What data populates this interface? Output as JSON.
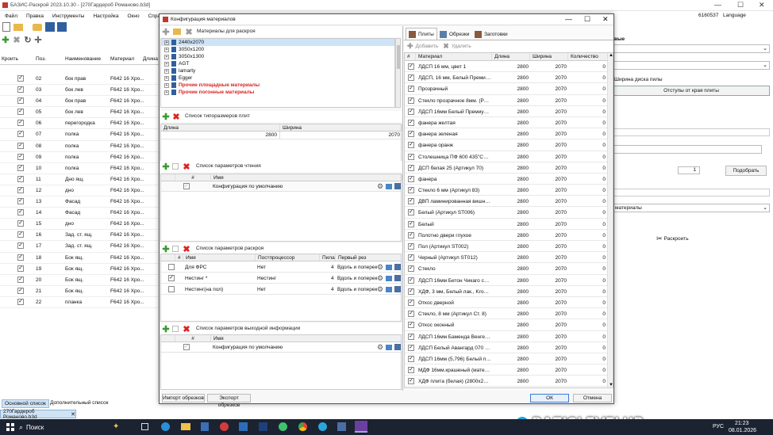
{
  "app": {
    "title": "БАЗИС-Раскрой 2023.10.30 - [270Гардероб Романово.b3d]",
    "menu": [
      "Файл",
      "Правка",
      "Инструменты",
      "Настройка",
      "Окно",
      "Справка"
    ],
    "status_num": "6160537",
    "language": "Language"
  },
  "left_table": {
    "columns": [
      "Кроить",
      "Поз.",
      "Наименование",
      "Материал",
      "Длина"
    ],
    "rows": [
      {
        "pos": "02",
        "name": "бок прав",
        "mat": "F642 16 Хро..."
      },
      {
        "pos": "03",
        "name": "бок лев",
        "mat": "F642 16 Хро..."
      },
      {
        "pos": "04",
        "name": "бок прав",
        "mat": "F642 16 Хро..."
      },
      {
        "pos": "05",
        "name": "бок лев",
        "mat": "F642 16 Хро..."
      },
      {
        "pos": "06",
        "name": "перегородка",
        "mat": "F642 16 Хро..."
      },
      {
        "pos": "07",
        "name": "полка",
        "mat": "F642 16 Хро..."
      },
      {
        "pos": "08",
        "name": "полка",
        "mat": "F642 16 Хро..."
      },
      {
        "pos": "09",
        "name": "полка",
        "mat": "F642 16 Хро..."
      },
      {
        "pos": "10",
        "name": "полка",
        "mat": "F642 16 Хро..."
      },
      {
        "pos": "11",
        "name": "Дно ящ.",
        "mat": "F642 16 Хро..."
      },
      {
        "pos": "12",
        "name": "дно",
        "mat": "F642 16 Хро..."
      },
      {
        "pos": "13",
        "name": "Фасад",
        "mat": "F642 16 Хро..."
      },
      {
        "pos": "14",
        "name": "Фасад",
        "mat": "F642 16 Хро..."
      },
      {
        "pos": "15",
        "name": "дно",
        "mat": "F642 16 Хро..."
      },
      {
        "pos": "16",
        "name": "Зад. ст. ящ.",
        "mat": "F642 16 Хро..."
      },
      {
        "pos": "17",
        "name": "Зад. ст. ящ.",
        "mat": "F642 16 Хро..."
      },
      {
        "pos": "18",
        "name": "Бок ящ.",
        "mat": "F642 16 Хро..."
      },
      {
        "pos": "19",
        "name": "Бок ящ.",
        "mat": "F642 16 Хро..."
      },
      {
        "pos": "20",
        "name": "Бок ящ.",
        "mat": "F642 16 Хро..."
      },
      {
        "pos": "21",
        "name": "Бок ящ.",
        "mat": "F642 16 Хро..."
      },
      {
        "pos": "22",
        "name": "планка",
        "mat": "F642 16 Хро..."
      }
    ],
    "tabs": [
      "Основной список",
      "Дополнительный список"
    ],
    "doc_tab": "270Гардероб Романово.b3d"
  },
  "right_panel": {
    "header": "вые",
    "label_disk": "Ширина диска пилы",
    "btn_offsets": "Отступы от края плиты",
    "stepper_value": "1",
    "btn_select": "Подобрать",
    "dropdown_mat": "материалы",
    "btn_cut": "Раскроить"
  },
  "dialog": {
    "title": "Конфигурация материалов",
    "materials": {
      "title": "Материалы для раскроя",
      "items": [
        "2440x2070",
        "3050x1200",
        "3050x1300",
        "AGT",
        "lamarty",
        "Egger"
      ],
      "special": [
        "Прочие площадные материалы",
        "Прочие погонные материалы"
      ]
    },
    "sizes": {
      "title": "Список типоразмеров плит",
      "col_len": "Длина",
      "col_wid": "Ширина",
      "len": "2800",
      "wid": "2070"
    },
    "read": {
      "title": "Список параметров чтения",
      "col_num": "#",
      "col_name": "Имя",
      "row_name": "Конфигурация по умолчанию"
    },
    "cut": {
      "title": "Список параметров раскроя",
      "cols": [
        "#",
        "Имя",
        "Постпроцессор",
        "Пила",
        "Первый рез"
      ],
      "rows": [
        {
          "checked": false,
          "name": "Для ФРС",
          "post": "Нет",
          "saw": "4",
          "first": "Вдоль и поперек"
        },
        {
          "checked": true,
          "name": "Нестинг *",
          "post": "Нестинг",
          "saw": "4",
          "first": "Вдоль и поперек"
        },
        {
          "checked": false,
          "name": "Нестинг(на пол)",
          "post": "Нет",
          "saw": "4",
          "first": "Вдоль и поперек"
        }
      ]
    },
    "out": {
      "title": "Список параметров выходной информации",
      "col_num": "#",
      "col_name": "Имя",
      "row_name": "Конфигурация по умолчанию"
    },
    "btn_import": "Импорт обрезков",
    "btn_export": "Экспорт обрезков",
    "tabs": [
      "Плиты",
      "Обрезки",
      "Заготовки"
    ],
    "btn_add": "Добавить",
    "btn_del": "Удалить",
    "sheets": {
      "cols": [
        "#",
        "Материал",
        "Длина",
        "Ширина",
        "Количество"
      ],
      "rows": [
        {
          "name": "ЛДСП 16 мм, цвет 1",
          "len": "2800",
          "wid": "2070",
          "qty": "0"
        },
        {
          "name": "ЛДСП, 16 мм, Белый Премиум, W...",
          "len": "2800",
          "wid": "2070",
          "qty": "0"
        },
        {
          "name": "Прозрачный",
          "len": "2800",
          "wid": "2070",
          "qty": "0"
        },
        {
          "name": "Стекло прозрачное 8мм. (Раз)%...",
          "len": "2800",
          "wid": "2070",
          "qty": "0"
        },
        {
          "name": "ЛДСП 16мм Белый ПремиумSM/ST...",
          "len": "2800",
          "wid": "2070",
          "qty": "0"
        },
        {
          "name": "фанера желтая",
          "len": "2800",
          "wid": "2070",
          "qty": "0"
        },
        {
          "name": "фанера зеленая",
          "len": "2800",
          "wid": "2070",
          "qty": "0"
        },
        {
          "name": "фанера оранж",
          "len": "2800",
          "wid": "2070",
          "qty": "0"
        },
        {
          "name": "Столешница ПФ 600 435\"Сагага\"...",
          "len": "2800",
          "wid": "2070",
          "qty": "0"
        },
        {
          "name": "ДСП белая 25 (Артикул 70)",
          "len": "2800",
          "wid": "2070",
          "qty": "0"
        },
        {
          "name": "фанера",
          "len": "2800",
          "wid": "2070",
          "qty": "0"
        },
        {
          "name": "Стекло 6 мм (Артикул 83)",
          "len": "2800",
          "wid": "2070",
          "qty": "0"
        },
        {
          "name": "ДВП ламинированная вишня (Ар...",
          "len": "2800",
          "wid": "2070",
          "qty": "0"
        },
        {
          "name": "Белый (Артикул ST006)",
          "len": "2800",
          "wid": "2070",
          "qty": "0"
        },
        {
          "name": "Белый",
          "len": "2800",
          "wid": "2070",
          "qty": "0"
        },
        {
          "name": "Полотно двери глухое",
          "len": "2800",
          "wid": "2070",
          "qty": "0"
        },
        {
          "name": "Пол (Артикул ST002)",
          "len": "2800",
          "wid": "2070",
          "qty": "0"
        },
        {
          "name": "Черный (Артикул ST012)",
          "len": "2800",
          "wid": "2070",
          "qty": "0"
        },
        {
          "name": "Стекло",
          "len": "2800",
          "wid": "2070",
          "qty": "0"
        },
        {
          "name": "ЛДСП 16мм Бетон Чикаго светло...",
          "len": "2800",
          "wid": "2070",
          "qty": "0"
        },
        {
          "name": "ХДФ, 3 мм, Белый лак., Kronostar...",
          "len": "2800",
          "wid": "2070",
          "qty": "0"
        },
        {
          "name": "Откос дверной",
          "len": "2800",
          "wid": "2070",
          "qty": "0"
        },
        {
          "name": "Стекло, 8 мм (Артикул Ст. 8)",
          "len": "2800",
          "wid": "2070",
          "qty": "0"
        },
        {
          "name": "Откос оконный",
          "len": "2800",
          "wid": "2070",
          "qty": "0"
        },
        {
          "name": "ЛДСП 16мм Бамендa Венге тёмн...",
          "len": "2800",
          "wid": "2070",
          "qty": "0"
        },
        {
          "name": "ЛДСП Белый Авангард 070 Р (27...",
          "len": "2800",
          "wid": "2070",
          "qty": "0"
        },
        {
          "name": "ЛДСП 16мм (5,796) Белый премиу...",
          "len": "2800",
          "wid": "2070",
          "qty": "0"
        },
        {
          "name": "МДФ 16мм.крашеный (материал ...",
          "len": "2800",
          "wid": "2070",
          "qty": "0"
        },
        {
          "name": "ХДФ плита (белая) (2800х2070х...",
          "len": "2800",
          "wid": "2070",
          "qty": "0"
        }
      ]
    },
    "btn_ok": "ОК",
    "btn_cancel": "Отмена"
  },
  "taskbar": {
    "search": "Поиск",
    "lang": "РУС",
    "time": "21:23",
    "date": "08.01.2026"
  },
  "watermark": "BAZISLEVELUP"
}
